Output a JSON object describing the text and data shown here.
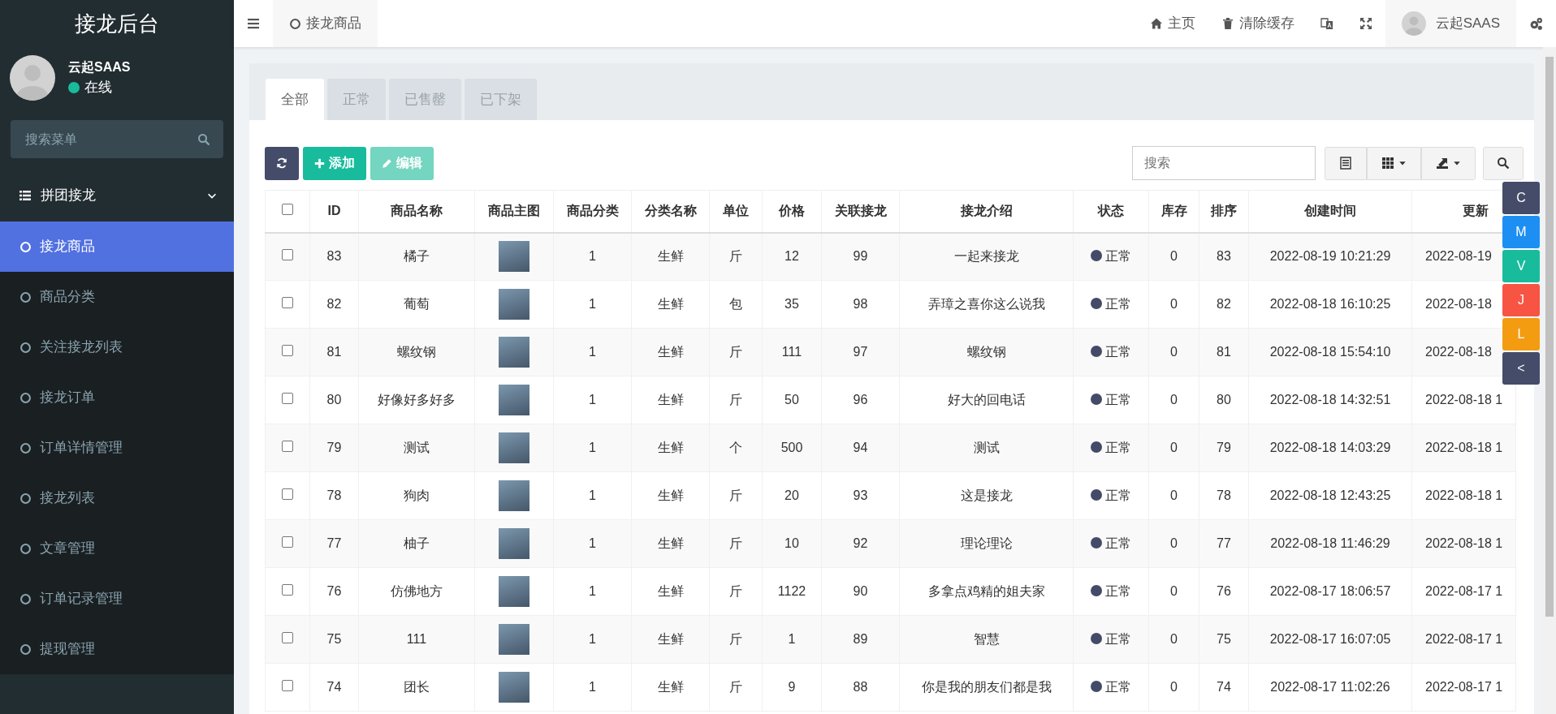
{
  "sidebar": {
    "title": "接龙后台",
    "user": {
      "name": "云起SAAS",
      "status": "在线",
      "online": true
    },
    "search": {
      "placeholder": "搜索菜单"
    },
    "menu": [
      {
        "label": "拼团接龙",
        "expanded": true,
        "children": [
          {
            "label": "接龙商品",
            "selected": true
          },
          {
            "label": "商品分类",
            "selected": false
          },
          {
            "label": "关注接龙列表",
            "selected": false
          },
          {
            "label": "接龙订单",
            "selected": false
          },
          {
            "label": "订单详情管理",
            "selected": false
          },
          {
            "label": "接龙列表",
            "selected": false
          },
          {
            "label": "文章管理",
            "selected": false
          },
          {
            "label": "订单记录管理",
            "selected": false
          },
          {
            "label": "提现管理",
            "selected": false
          }
        ]
      }
    ]
  },
  "topbar": {
    "page_tab": "接龙商品",
    "links": [
      {
        "kind": "home",
        "label": "主页"
      },
      {
        "kind": "trash",
        "label": "清除缓存"
      },
      {
        "kind": "translate"
      },
      {
        "kind": "fullscreen"
      }
    ],
    "user": "云起SAAS"
  },
  "tabs": [
    {
      "label": "全部",
      "selected": true
    },
    {
      "label": "正常",
      "selected": false
    },
    {
      "label": "已售罄",
      "selected": false
    },
    {
      "label": "已下架",
      "selected": false
    }
  ],
  "toolbar": {
    "add": "添加",
    "edit": "编辑",
    "edit_disabled": true,
    "search": {
      "placeholder": "搜索"
    }
  },
  "table": {
    "select_all": {
      "checked": false
    },
    "columns": [
      "ID",
      "商品名称",
      "商品主图",
      "商品分类",
      "分类名称",
      "单位",
      "价格",
      "关联接龙",
      "接龙介绍",
      "状态",
      "库存",
      "排序",
      "创建时间",
      "更新"
    ],
    "rows": [
      {
        "checked": false,
        "cells": [
          "83",
          "橘子",
          "",
          "1",
          "生鲜",
          "斤",
          "12",
          "99",
          "一起来接龙",
          "正常",
          "0",
          "83",
          "2022-08-19 10:21:29",
          "2022-08-19"
        ]
      },
      {
        "checked": false,
        "cells": [
          "82",
          "葡萄",
          "",
          "1",
          "生鲜",
          "包",
          "35",
          "98",
          "弄璋之喜你这么说我",
          "正常",
          "0",
          "82",
          "2022-08-18 16:10:25",
          "2022-08-18"
        ]
      },
      {
        "checked": false,
        "cells": [
          "81",
          "螺纹钢",
          "",
          "1",
          "生鲜",
          "斤",
          "111",
          "97",
          "螺纹钢",
          "正常",
          "0",
          "81",
          "2022-08-18 15:54:10",
          "2022-08-18"
        ]
      },
      {
        "checked": false,
        "cells": [
          "80",
          "好像好多好多",
          "",
          "1",
          "生鲜",
          "斤",
          "50",
          "96",
          "好大的回电话",
          "正常",
          "0",
          "80",
          "2022-08-18 14:32:51",
          "2022-08-18 1"
        ]
      },
      {
        "checked": false,
        "cells": [
          "79",
          "测试",
          "",
          "1",
          "生鲜",
          "个",
          "500",
          "94",
          "测试",
          "正常",
          "0",
          "79",
          "2022-08-18 14:03:29",
          "2022-08-18 1"
        ]
      },
      {
        "checked": false,
        "cells": [
          "78",
          "狗肉",
          "",
          "1",
          "生鲜",
          "斤",
          "20",
          "93",
          "这是接龙",
          "正常",
          "0",
          "78",
          "2022-08-18 12:43:25",
          "2022-08-18 1"
        ]
      },
      {
        "checked": false,
        "cells": [
          "77",
          "柚子",
          "",
          "1",
          "生鲜",
          "斤",
          "10",
          "92",
          "理论理论",
          "正常",
          "0",
          "77",
          "2022-08-18 11:46:29",
          "2022-08-18 1"
        ]
      },
      {
        "checked": false,
        "cells": [
          "76",
          "仿佛地方",
          "",
          "1",
          "生鲜",
          "斤",
          "1122",
          "90",
          "多拿点鸡精的姐夫家",
          "正常",
          "0",
          "76",
          "2022-08-17 18:06:57",
          "2022-08-17 1"
        ]
      },
      {
        "checked": false,
        "cells": [
          "75",
          "111",
          "",
          "1",
          "生鲜",
          "斤",
          "1",
          "89",
          "智慧",
          "正常",
          "0",
          "75",
          "2022-08-17 16:07:05",
          "2022-08-17 1"
        ]
      },
      {
        "checked": false,
        "cells": [
          "74",
          "团长",
          "",
          "1",
          "生鲜",
          "斤",
          "9",
          "88",
          "你是我的朋友们都是我",
          "正常",
          "0",
          "74",
          "2022-08-17 11:02:26",
          "2022-08-17 1"
        ]
      }
    ]
  },
  "float_buttons": [
    {
      "label": "C",
      "color": "#444c69"
    },
    {
      "label": "M",
      "color": "#1e8ff2"
    },
    {
      "label": "V",
      "color": "#18bc9c"
    },
    {
      "label": "J",
      "color": "#f75444"
    },
    {
      "label": "L",
      "color": "#f39c12"
    },
    {
      "label": "<",
      "color": "#444c69"
    }
  ]
}
